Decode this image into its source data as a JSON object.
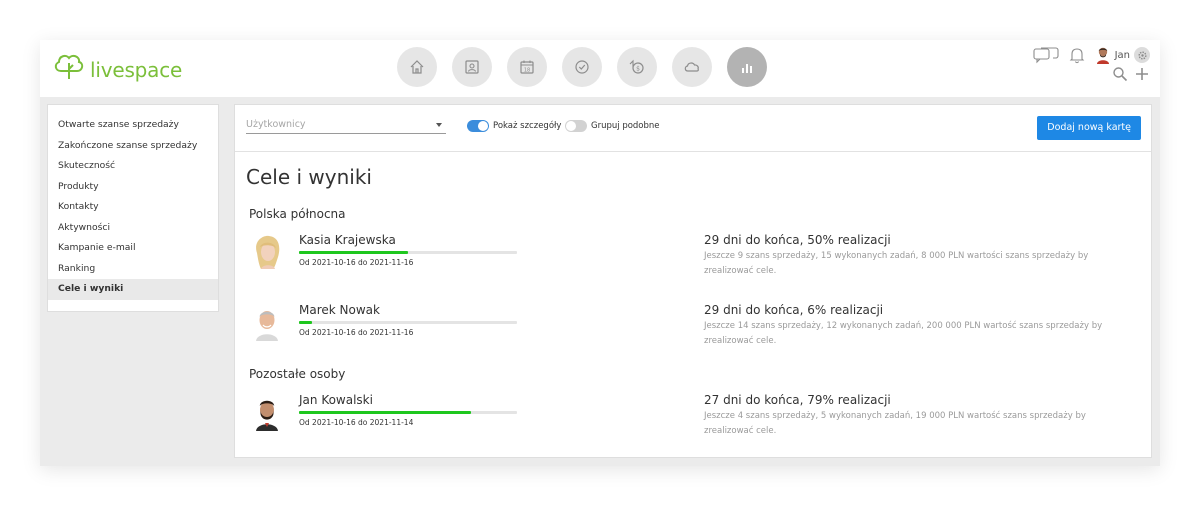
{
  "app": {
    "logo_text": "livespace",
    "brand_color": "#7bbf3a",
    "accent_color": "#1e88e5"
  },
  "nav": [
    {
      "icon": "home-icon"
    },
    {
      "icon": "contacts-icon"
    },
    {
      "icon": "calendar-icon",
      "text": "18"
    },
    {
      "icon": "tasks-icon"
    },
    {
      "icon": "deals-icon"
    },
    {
      "icon": "cloud-icon"
    },
    {
      "icon": "reports-icon",
      "active": true
    }
  ],
  "user": {
    "name": "Jan"
  },
  "sidebar": {
    "items": [
      {
        "label": "Otwarte szanse sprzedaży"
      },
      {
        "label": "Zakończone szanse sprzedaży"
      },
      {
        "label": "Skuteczność"
      },
      {
        "label": "Produkty"
      },
      {
        "label": "Kontakty"
      },
      {
        "label": "Aktywności"
      },
      {
        "label": "Kampanie e-mail"
      },
      {
        "label": "Ranking"
      },
      {
        "label": "Cele i wyniki",
        "active": true
      }
    ]
  },
  "toolbar": {
    "users_placeholder": "Użytkownicy",
    "show_details_label": "Pokaż szczegóły",
    "show_details_on": true,
    "group_similar_label": "Grupuj podobne",
    "group_similar_on": false,
    "add_card_label": "Dodaj nową kartę"
  },
  "page": {
    "title": "Cele i wyniki",
    "groups": [
      {
        "title": "Polska północna",
        "people": [
          {
            "name": "Kasia Krajewska",
            "period": "Od 2021-10-16 do 2021-11-16",
            "progress": 0.5,
            "status": "29 dni do końca, 50% realizacji",
            "desc": "Jeszcze 9 szans sprzedaży, 15 wykonanych zadań, 8 000 PLN wartości szans sprzedaży by zrealizować cele."
          },
          {
            "name": "Marek Nowak",
            "period": "Od 2021-10-16 do 2021-11-16",
            "progress": 0.06,
            "status": "29 dni do końca, 6% realizacji",
            "desc": "Jeszcze 14 szans sprzedaży, 12 wykonanych zadań, 200 000 PLN wartość szans sprzedaży by zrealizować cele."
          }
        ]
      },
      {
        "title": "Pozostałe osoby",
        "people": [
          {
            "name": "Jan Kowalski",
            "period": "Od 2021-10-16 do 2021-11-14",
            "progress": 0.79,
            "status": "27 dni do końca, 79% realizacji",
            "desc": "Jeszcze 4 szans sprzedaży, 5 wykonanych zadań, 19 000 PLN wartość szans sprzedaży by zrealizować cele."
          }
        ]
      }
    ]
  }
}
